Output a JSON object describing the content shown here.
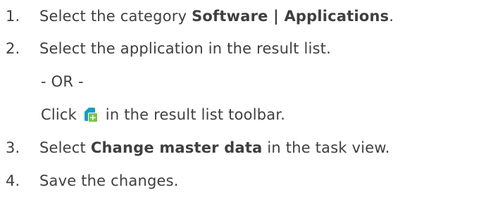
{
  "steps": [
    {
      "number": "1.",
      "before": "Select the category ",
      "bold": "Software | Applications",
      "after": "."
    },
    {
      "number": "2.",
      "text": "Select the application in the result list."
    },
    {
      "or_text": "- OR -"
    },
    {
      "before": "Click ",
      "icon": "new-document-plus-icon",
      "after": " in the result list toolbar."
    },
    {
      "number": "3.",
      "before": "Select ",
      "bold": "Change master data",
      "after": " in the task view."
    },
    {
      "number": "4.",
      "text": "Save the changes."
    }
  ],
  "colors": {
    "text": "#3f3f3f",
    "icon_page": "#0aa1c6",
    "icon_plus": "#7cc242"
  }
}
